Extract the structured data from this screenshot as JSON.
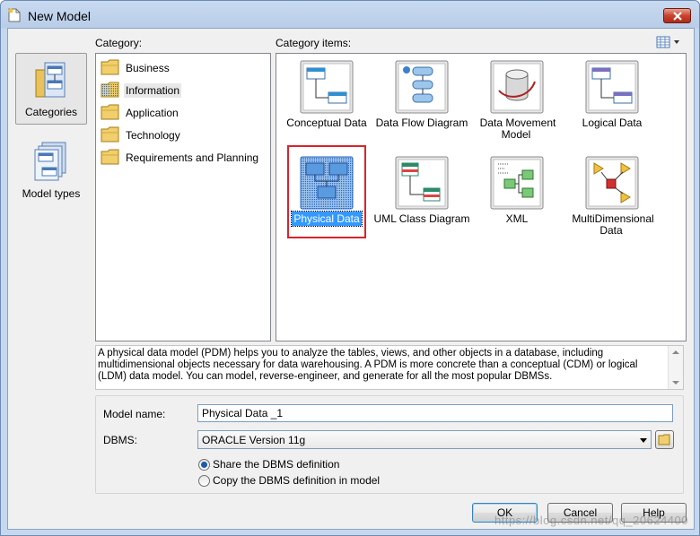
{
  "window": {
    "title": "New Model"
  },
  "left_tabs": [
    {
      "label": "Categories",
      "selected": true
    },
    {
      "label": "Model types",
      "selected": false
    }
  ],
  "category_label": "Category:",
  "category_items_label": "Category items:",
  "categories": [
    {
      "label": "Business"
    },
    {
      "label": "Information",
      "selected": true
    },
    {
      "label": "Application"
    },
    {
      "label": "Technology"
    },
    {
      "label": "Requirements and Planning"
    }
  ],
  "items": [
    {
      "label": "Conceptual Data",
      "icon": "conceptual-data-icon"
    },
    {
      "label": "Data Flow Diagram",
      "icon": "data-flow-diagram-icon"
    },
    {
      "label": "Data Movement Model",
      "icon": "data-movement-model-icon"
    },
    {
      "label": "Logical Data",
      "icon": "logical-data-icon"
    },
    {
      "label": "Physical Data",
      "icon": "physical-data-icon",
      "selected": true
    },
    {
      "label": "UML Class Diagram",
      "icon": "uml-class-diagram-icon"
    },
    {
      "label": "XML",
      "icon": "xml-icon"
    },
    {
      "label": "MultiDimensional Data",
      "icon": "multidimensional-data-icon"
    }
  ],
  "description": "A physical data model (PDM) helps you to analyze the tables, views, and other objects in a database, including multidimensional objects necessary for data warehousing. A PDM is more concrete than a conceptual (CDM) or logical (LDM) data model. You can model, reverse-engineer, and generate for all the most popular DBMSs.",
  "form": {
    "model_name_label": "Model name:",
    "model_name_value": "Physical Data _1",
    "dbms_label": "DBMS:",
    "dbms_value": "ORACLE Version 11g",
    "share_label": "Share the DBMS definition",
    "copy_label": "Copy the DBMS definition in model",
    "share_selected": true
  },
  "buttons": {
    "ok": "OK",
    "cancel": "Cancel",
    "help": "Help"
  },
  "watermark": "https://blog.csdn.net/qq_20624400",
  "colors": {
    "selection": "#3399ff",
    "highlight_border": "#d9232a",
    "title_bar": "#c9daf0"
  }
}
